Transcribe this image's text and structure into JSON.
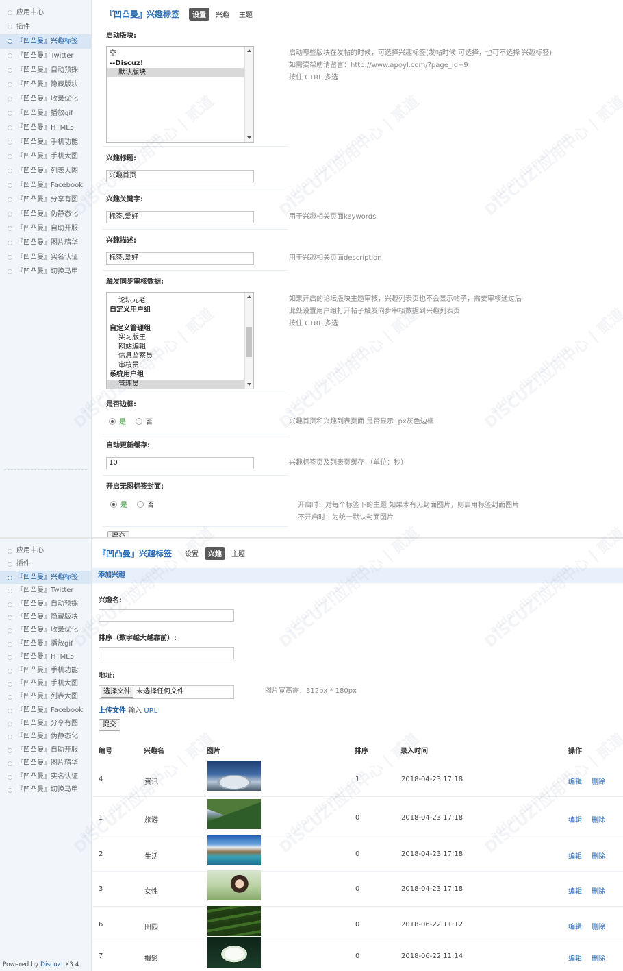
{
  "sidebar_top": {
    "items": [
      {
        "label": "应用中心",
        "active": false
      },
      {
        "label": "插件",
        "active": false
      },
      {
        "label": "『凹凸曼』兴趣标签",
        "active": true
      },
      {
        "label": "『凹凸曼』Twitter",
        "active": false
      },
      {
        "label": "『凹凸曼』自动预採",
        "active": false
      },
      {
        "label": "『凹凸曼』隐藏版块",
        "active": false
      },
      {
        "label": "『凹凸曼』收录优化",
        "active": false
      },
      {
        "label": "『凹凸曼』播放gif",
        "active": false
      },
      {
        "label": "『凹凸曼』HTML5",
        "active": false
      },
      {
        "label": "『凹凸曼』手机功能",
        "active": false
      },
      {
        "label": "『凹凸曼』手机大图",
        "active": false
      },
      {
        "label": "『凹凸曼』列表大图",
        "active": false
      },
      {
        "label": "『凹凸曼』Facebook",
        "active": false
      },
      {
        "label": "『凹凸曼』分享有图",
        "active": false
      },
      {
        "label": "『凹凸曼』伪静态化",
        "active": false
      },
      {
        "label": "『凹凸曼』自助开服",
        "active": false
      },
      {
        "label": "『凹凸曼』图片精华",
        "active": false
      },
      {
        "label": "『凹凸曼』实名认证",
        "active": false
      },
      {
        "label": "『凹凸曼』切换马甲",
        "active": false
      }
    ]
  },
  "sidebar_bottom": {
    "items": [
      {
        "label": "应用中心",
        "active": false
      },
      {
        "label": "插件",
        "active": false
      },
      {
        "label": "『凹凸曼』兴趣标签",
        "active": true
      },
      {
        "label": "『凹凸曼』Twitter",
        "active": false
      },
      {
        "label": "『凹凸曼』自动预採",
        "active": false
      },
      {
        "label": "『凹凸曼』隐藏版块",
        "active": false
      },
      {
        "label": "『凹凸曼』收录优化",
        "active": false
      },
      {
        "label": "『凹凸曼』播放gif",
        "active": false
      },
      {
        "label": "『凹凸曼』HTML5",
        "active": false
      },
      {
        "label": "『凹凸曼』手机功能",
        "active": false
      },
      {
        "label": "『凹凸曼』手机大图",
        "active": false
      },
      {
        "label": "『凹凸曼』列表大图",
        "active": false
      },
      {
        "label": "『凹凸曼』Facebook",
        "active": false
      },
      {
        "label": "『凹凸曼』分享有图",
        "active": false
      },
      {
        "label": "『凹凸曼』伪静态化",
        "active": false
      },
      {
        "label": "『凹凸曼』自助开服",
        "active": false
      },
      {
        "label": "『凹凸曼』图片精华",
        "active": false
      },
      {
        "label": "『凹凸曼』实名认证",
        "active": false
      },
      {
        "label": "『凹凸曼』切换马甲",
        "active": false
      }
    ],
    "powered_prefix": "Powered by ",
    "powered_brand": "Discuz!",
    "powered_version": " X3.4"
  },
  "settings": {
    "title": "『凹凸曼』兴趣标签",
    "tabs": [
      {
        "label": "设置",
        "active": true
      },
      {
        "label": "兴趣",
        "active": false
      },
      {
        "label": "主题",
        "active": false
      }
    ],
    "startup_block": {
      "label": "启动版块:",
      "options": [
        "空",
        "--Discuz!",
        "默认版块"
      ],
      "selected": "默认版块",
      "hint1": "启动哪些版块在发帖的时候，可选择兴趣标签(发帖时候 可选择，也可不选择 兴趣标签)",
      "hint2": "如需要帮助请留言：http://www.apoyl.com/?page_id=9",
      "hint3": "按住 CTRL 多选"
    },
    "interest_title": {
      "label": "兴趣标题:",
      "value": "兴趣首页"
    },
    "interest_keywords": {
      "label": "兴趣关键字:",
      "value": "标签,爱好",
      "hint": "用于兴趣相关页面keywords"
    },
    "interest_desc": {
      "label": "兴趣描述:",
      "value": "标签,爱好",
      "hint": "用于兴趣相关页面description"
    },
    "sync_review": {
      "label": "触发同步审核数据:",
      "options": [
        {
          "text": "论坛元老",
          "kind": "sub"
        },
        {
          "text": "自定义用户组",
          "kind": "grp"
        },
        {
          "text": "",
          "kind": "blank"
        },
        {
          "text": "自定义管理组",
          "kind": "grp"
        },
        {
          "text": "实习版主",
          "kind": "sub"
        },
        {
          "text": "网站编辑",
          "kind": "sub"
        },
        {
          "text": "信息监察员",
          "kind": "sub"
        },
        {
          "text": "审核员",
          "kind": "sub"
        },
        {
          "text": "系统用户组",
          "kind": "grp"
        },
        {
          "text": "管理员",
          "kind": "sub"
        }
      ],
      "selected": "管理员",
      "hint1": "如果开启的论坛版块主题审核，兴趣列表页也不会显示帖子，需要审核通过后",
      "hint2": "此处设置用户组打开帖子触发同步审核数据到兴趣列表页",
      "hint3": "按住 CTRL 多选"
    },
    "border": {
      "label": "是否边框:",
      "yes": "是",
      "no": "否",
      "value": "是",
      "hint": "兴趣首页和兴趣列表页面 是否显示1px灰色边框"
    },
    "cache": {
      "label": "自动更新缓存:",
      "value": "10",
      "hint": "兴趣标签页及列表页缓存 （单位：秒）"
    },
    "no_image_cover": {
      "label": "开启无图标签封面:",
      "yes": "是",
      "no": "否",
      "value": "是",
      "hint1": "开启时：对每个标签下的主题 如果木有无封面图片，则启用标签封面图片",
      "hint2": "不开启时：为统一默认封面图片"
    },
    "submit_label": "提交"
  },
  "interests": {
    "title": "『凹凸曼』兴趣标签",
    "tabs": [
      {
        "label": "设置",
        "active": false
      },
      {
        "label": "兴趣",
        "active": true
      },
      {
        "label": "主题",
        "active": false
      }
    ],
    "section_title": "添加兴趣",
    "name_label": "兴趣名:",
    "name_value": "",
    "order_label": "排序（数字越大越靠前）:",
    "order_value": "",
    "address_label": "地址:",
    "file_button": "选择文件",
    "file_status": "未选择任何文件",
    "size_hint": "图片宽高需：312px * 180px",
    "upload_link": "上传文件",
    "url_prefix": "输入",
    "url_link": "URL",
    "submit_label": "提交",
    "columns": [
      "编号",
      "兴趣名",
      "图片",
      "排序",
      "录入时间",
      "操作"
    ],
    "rows": [
      {
        "id": "4",
        "name": "资讯",
        "image": "building-dome",
        "order": "1",
        "time": "2018-04-23 17:18",
        "edit": "编辑",
        "delete": "删除"
      },
      {
        "id": "1",
        "name": "旅游",
        "image": "mountain-valley",
        "order": "0",
        "time": "2018-04-23 17:18",
        "edit": "编辑",
        "delete": "删除"
      },
      {
        "id": "2",
        "name": "生活",
        "image": "lake-landscape",
        "order": "0",
        "time": "2018-04-23 17:18",
        "edit": "编辑",
        "delete": "删除"
      },
      {
        "id": "3",
        "name": "女性",
        "image": "woman-portrait",
        "order": "0",
        "time": "2018-04-23 17:18",
        "edit": "编辑",
        "delete": "删除"
      },
      {
        "id": "6",
        "name": "田园",
        "image": "rice-terraces",
        "order": "0",
        "time": "2018-06-22 11:12",
        "edit": "编辑",
        "delete": "删除"
      },
      {
        "id": "7",
        "name": "摄影",
        "image": "white-lotus",
        "order": "0",
        "time": "2018-06-22 11:14",
        "edit": "编辑",
        "delete": "删除"
      }
    ]
  },
  "watermark": {
    "line1": "DISCUZ!应用中心 | 贰道",
    "line2": "addon.dismall.com"
  },
  "colors": {
    "link": "#2a6db8",
    "active_tab": "#5a5a5a",
    "sidebar_bg": "#f2f6fb",
    "yes_green": "#2a9a2a"
  }
}
